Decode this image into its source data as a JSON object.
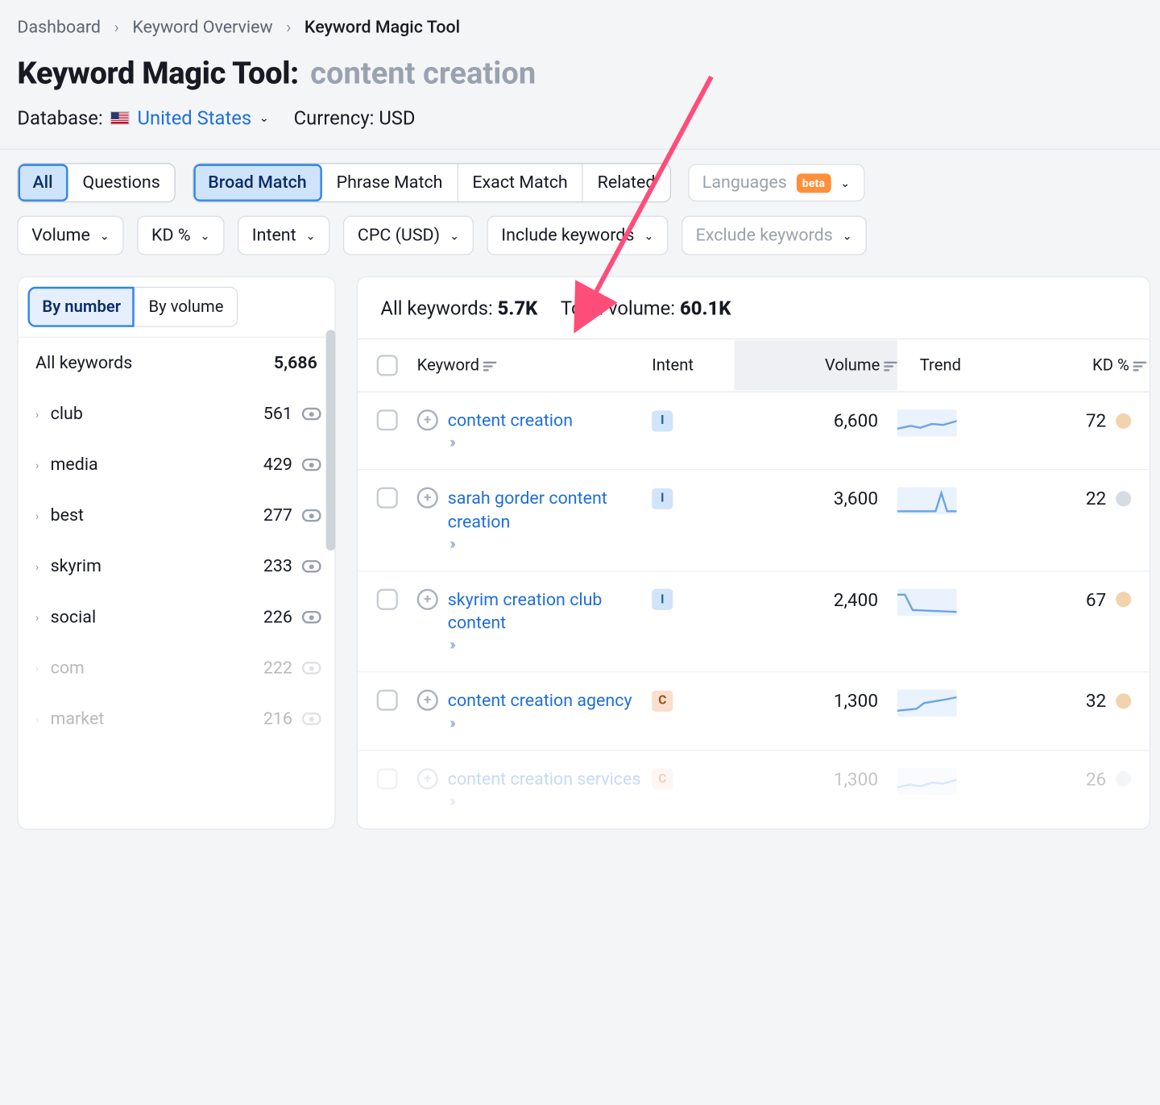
{
  "breadcrumb": {
    "a": "Dashboard",
    "b": "Keyword Overview",
    "c": "Keyword Magic Tool"
  },
  "page": {
    "title": "Keyword Magic Tool:",
    "term": "content creation"
  },
  "meta": {
    "dbLabel": "Database:",
    "dbName": "United States",
    "curLabel": "Currency:",
    "curVal": "USD"
  },
  "scope": {
    "all": "All",
    "questions": "Questions"
  },
  "match": {
    "broad": "Broad Match",
    "phrase": "Phrase Match",
    "exact": "Exact Match",
    "related": "Related"
  },
  "langChip": {
    "label": "Languages",
    "beta": "beta"
  },
  "filters": {
    "volume": "Volume",
    "kd": "KD %",
    "intent": "Intent",
    "cpc": "CPC (USD)",
    "include": "Include keywords",
    "exclude": "Exclude keywords"
  },
  "sidebarTabs": {
    "byNumber": "By number",
    "byVolume": "By volume"
  },
  "sidebarHeader": {
    "label": "All keywords",
    "count": "5,686"
  },
  "sidebarItems": [
    {
      "name": "club",
      "count": "561"
    },
    {
      "name": "media",
      "count": "429"
    },
    {
      "name": "best",
      "count": "277"
    },
    {
      "name": "skyrim",
      "count": "233"
    },
    {
      "name": "social",
      "count": "226"
    },
    {
      "name": "com",
      "count": "222"
    },
    {
      "name": "market",
      "count": "216"
    }
  ],
  "totals": {
    "allLabel": "All keywords:",
    "allVal": "5.7K",
    "volLabel": "Total volume:",
    "volVal": "60.1K"
  },
  "columns": {
    "kw": "Keyword",
    "intent": "Intent",
    "volume": "Volume",
    "trend": "Trend",
    "kd": "KD %"
  },
  "rows": [
    {
      "keyword": "content creation",
      "intent": "I",
      "volume": "6,600",
      "kd": "72",
      "kdClass": "kd-c-72",
      "trend": "flat"
    },
    {
      "keyword": "sarah gorder content creation",
      "intent": "I",
      "volume": "3,600",
      "kd": "22",
      "kdClass": "kd-c-22",
      "trend": "spike"
    },
    {
      "keyword": "skyrim creation club content",
      "intent": "I",
      "volume": "2,400",
      "kd": "67",
      "kdClass": "kd-c-67",
      "trend": "drop"
    },
    {
      "keyword": "content creation agency",
      "intent": "C",
      "volume": "1,300",
      "kd": "32",
      "kdClass": "kd-c-32",
      "trend": "rise"
    },
    {
      "keyword": "content creation services",
      "intent": "C",
      "volume": "1,300",
      "kd": "26",
      "kdClass": "kd-c-26",
      "trend": "flat"
    }
  ]
}
